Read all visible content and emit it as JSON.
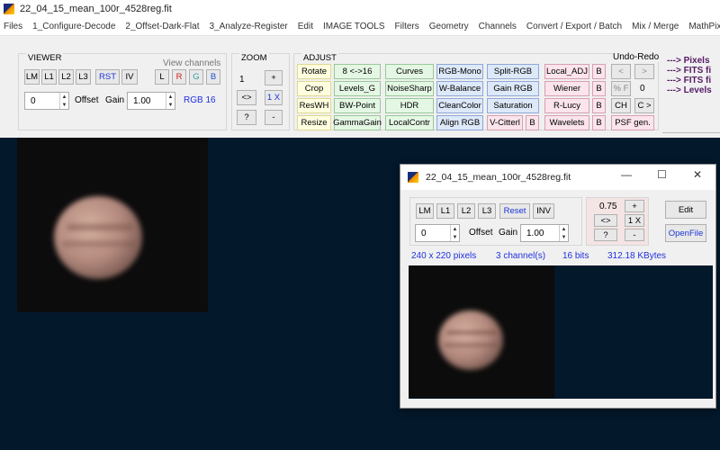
{
  "window": {
    "title": "22_04_15_mean_100r_4528reg.fit"
  },
  "menu": [
    "Files",
    "1_Configure-Decode",
    "2_Offset-Dark-Flat",
    "3_Analyze-Register",
    "Edit",
    "IMAGE TOOLS",
    "Filters",
    "Geometry",
    "Channels",
    "Convert / Export / Batch",
    "Mix / Merge",
    "MathPix"
  ],
  "viewer": {
    "label": "VIEWER",
    "view_channels_label": "View channels",
    "buttons": [
      "LM",
      "L1",
      "L2",
      "L3",
      "RST",
      "IV"
    ],
    "channel_buttons": [
      "L",
      "R",
      "G",
      "B"
    ],
    "offset_value": "0",
    "offset_label": "Offset",
    "gain_label": "Gain",
    "gain_value": "1.00",
    "mode": "RGB 16"
  },
  "zoom": {
    "label": "ZOOM",
    "level": "1",
    "plus": "+",
    "fit": "<>",
    "onex": "1 X",
    "help": "?",
    "minus": "-"
  },
  "adjust": {
    "label": "ADJUST",
    "undo_label": "Undo-Redo",
    "rows": [
      [
        "Rotate",
        "8 <->16",
        "Curves",
        "RGB-Mono",
        "Split-RGB",
        "Local_ADJ",
        "B"
      ],
      [
        "Crop",
        "Levels_G",
        "NoiseSharp",
        "W-Balance",
        "Gain RGB",
        "Wiener",
        "B"
      ],
      [
        "ResWH",
        "BW-Point",
        "HDR",
        "CleanColor",
        "Saturation",
        "R-Lucy",
        "B"
      ],
      [
        "Resize",
        "GammaGain",
        "LocalContr",
        "Align RGB",
        "V-Citterl",
        "B",
        "Wavelets",
        "B",
        "PSF gen."
      ]
    ],
    "undo": "<",
    "redo": ">",
    "pct": "% F",
    "count": "0",
    "ch": "CH",
    "cnext": "C >"
  },
  "info_links": [
    "---> Pixels",
    "---> FITS fi",
    "---> FITS fi",
    "---> Levels"
  ],
  "subwindow": {
    "title": "22_04_15_mean_100r_4528reg.fit",
    "buttons": [
      "LM",
      "L1",
      "L2",
      "L3",
      "Reset",
      "INV"
    ],
    "offset_value": "0",
    "offset_label": "Offset",
    "gain_label": "Gain",
    "gain_value": "1.00",
    "zoom_value": "0.75",
    "plus": "+",
    "fit": "<>",
    "onex": "1 X",
    "help": "?",
    "minus": "-",
    "edit": "Edit",
    "openfile": "OpenFile",
    "info": [
      "240  x  220  pixels",
      "3  channel(s)",
      "16 bits",
      "312.18 KBytes"
    ],
    "min_icon": "—",
    "max_icon": "☐",
    "close_icon": "✕"
  },
  "colors": {
    "workspace_bg": "#03182b",
    "accent_blue": "#2030e0",
    "link_purple": "#551a66"
  }
}
